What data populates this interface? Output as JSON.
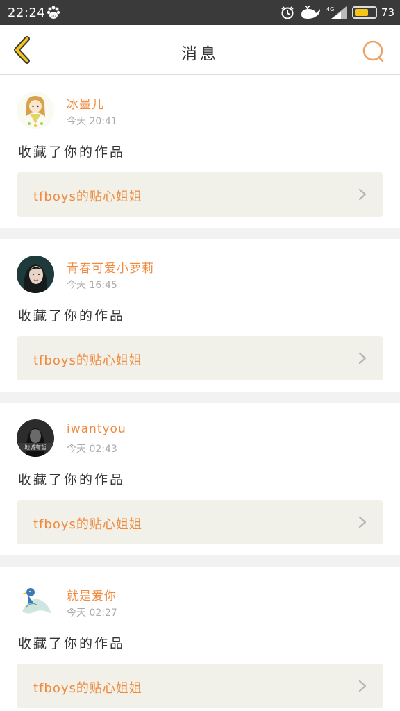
{
  "status_bar": {
    "time": "22:24",
    "battery": "73",
    "battery_level": 0.73,
    "network": "4G",
    "icons": [
      "paw-icon",
      "alarm-icon",
      "whale-icon",
      "signal-icon",
      "battery-icon"
    ]
  },
  "header": {
    "title": "消息",
    "back_icon": "chevron-left-icon",
    "search_icon": "search-icon",
    "accent_color": "#f5c518",
    "search_color": "#f0a060"
  },
  "colors": {
    "name": "#f08a3e",
    "time": "#aaaaaa",
    "work_bg": "#f1f1e9"
  },
  "messages": [
    {
      "name": "冰墨儿",
      "time": "今天 20:41",
      "action": "收藏了你的作品",
      "work": "tfboys的贴心姐姐",
      "avatar": "girl-cartoon-avatar"
    },
    {
      "name": "青春可爱小萝莉",
      "time": "今天 16:45",
      "action": "收藏了你的作品",
      "work": "tfboys的贴心姐姐",
      "avatar": "portrait-photo-avatar"
    },
    {
      "name": "iwantyou",
      "time": "今天 02:43",
      "action": "收藏了你的作品",
      "work": "tfboys的贴心姐姐",
      "avatar": "bw-photo-avatar",
      "avatar_text": "地城有哲"
    },
    {
      "name": "就是爱你",
      "time": "今天 02:27",
      "action": "收藏了你的作品",
      "work": "tfboys的贴心姐姐",
      "avatar": "blue-bird-avatar"
    }
  ]
}
